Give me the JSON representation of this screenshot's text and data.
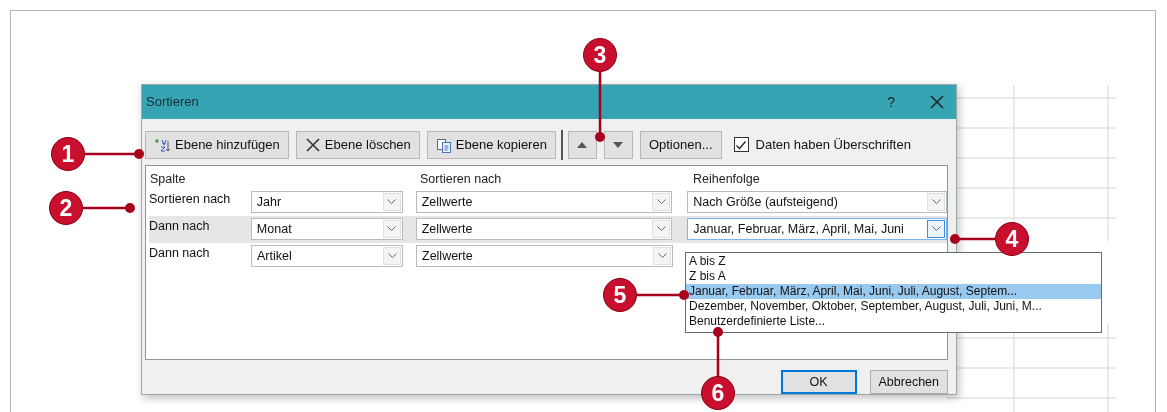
{
  "window": {
    "title": "Sortieren",
    "help": "?"
  },
  "toolbar": [
    {
      "kind": "add",
      "label": "Ebene hinzufügen"
    },
    {
      "kind": "delete",
      "label": "Ebene löschen"
    },
    {
      "kind": "copy",
      "label": "Ebene kopieren"
    },
    {
      "kind": "up"
    },
    {
      "kind": "down"
    },
    {
      "kind": "text",
      "label": "Optionen..."
    }
  ],
  "header_checkbox": {
    "label": "Daten haben Überschriften",
    "checked": true
  },
  "columns": [
    "Spalte",
    "Sortieren nach",
    "Reihenfolge"
  ],
  "rows": [
    {
      "label": "Sortieren nach",
      "column": "Jahr",
      "sort_on": "Zellwerte",
      "order": "Nach Größe (aufsteigend)",
      "selected": false
    },
    {
      "label": "Dann nach",
      "column": "Monat",
      "sort_on": "Zellwerte",
      "order": "Januar, Februar, März, April, Mai, Juni",
      "selected": true,
      "order_options": [
        {
          "label": "A bis Z",
          "selected": false
        },
        {
          "label": "Z bis A",
          "selected": false
        },
        {
          "label": "Januar, Februar, März, April, Mai, Juni, Juli, August, Septem...",
          "selected": true
        },
        {
          "label": "Dezember, November, Oktober, September, August, Juli, Juni, M...",
          "selected": false
        },
        {
          "label": "Benutzerdefinierte Liste...",
          "selected": false
        }
      ]
    },
    {
      "label": "Dann nach",
      "column": "Artikel",
      "sort_on": "Zellwerte",
      "selected": false
    }
  ],
  "buttons": [
    {
      "label": "OK",
      "default": true
    },
    {
      "label": "Abbrechen",
      "default": false
    }
  ],
  "callouts": [
    "1",
    "2",
    "3",
    "4",
    "5",
    "6"
  ]
}
